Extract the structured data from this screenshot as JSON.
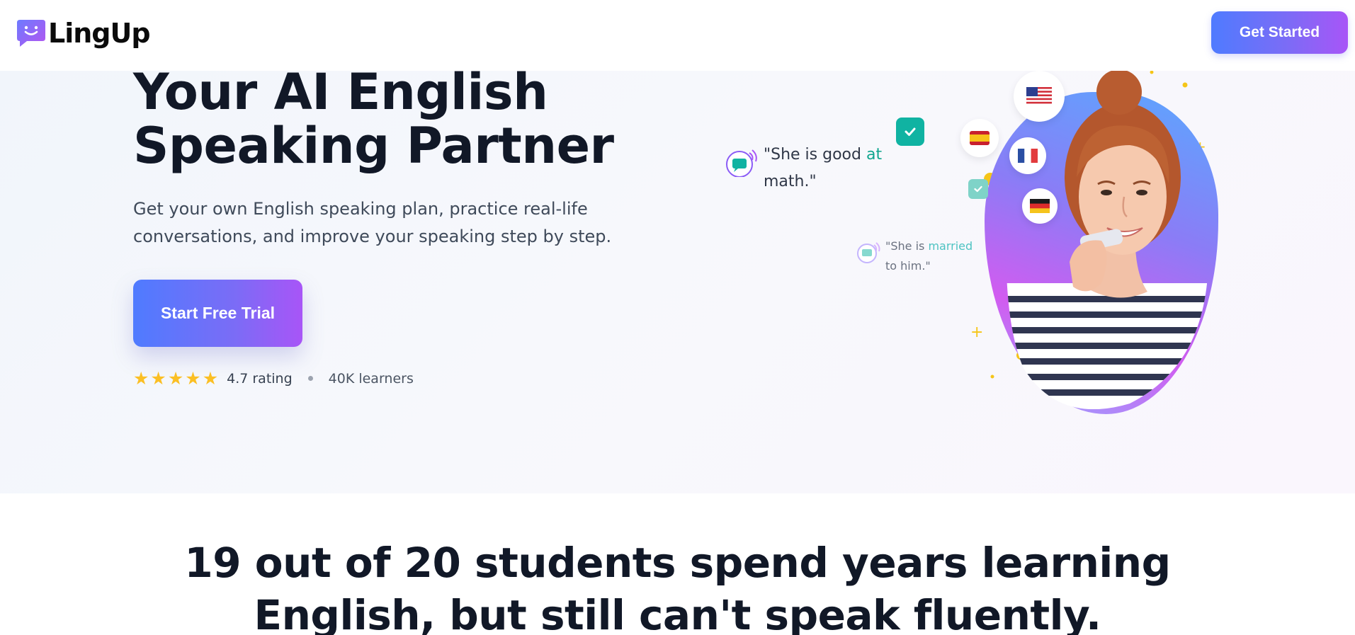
{
  "brand": {
    "name": "LingUp"
  },
  "header": {
    "cta_label": "Get Started"
  },
  "hero": {
    "title_line1": "Your AI English",
    "title_line2": "Speaking Partner",
    "subtitle_line1": "Get your own English speaking plan, practice real-life",
    "subtitle_line2": "conversations, and improve your speaking step by step.",
    "cta_label": "Start Free Trial",
    "rating_text": "4.7 rating",
    "rating_value": 4.7,
    "stars_shown": 5,
    "learners_text": "40K learners"
  },
  "illustration": {
    "bubble1": {
      "before": "\"She is good ",
      "highlight": "at",
      "after": "math.\""
    },
    "bubble2": {
      "before": "\"She is ",
      "highlight": "married",
      "after": "to him.\""
    },
    "flags": [
      "us-flag",
      "spain-flag",
      "france-flag",
      "germany-flag"
    ]
  },
  "section2": {
    "title_line1": "19 out of 20 students spend years learning",
    "title_line2": "English, but still can't speak fluently."
  },
  "colors": {
    "accent_start": "#4f7bff",
    "accent_end": "#a855f7",
    "check_green": "#10b3a2",
    "star": "#fbbf24"
  }
}
